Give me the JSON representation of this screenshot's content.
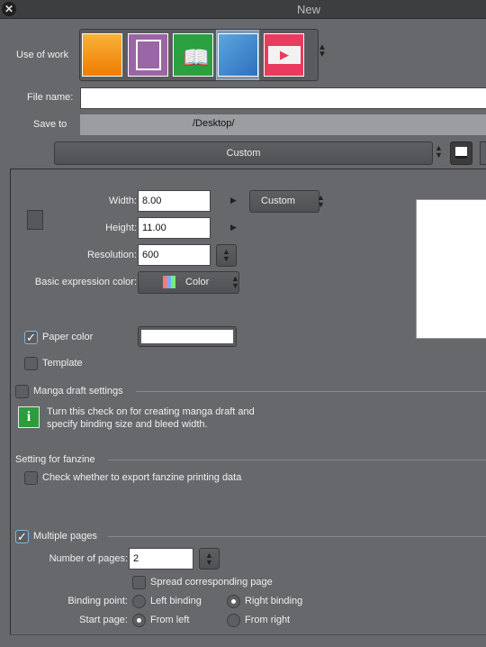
{
  "window": {
    "title": "New"
  },
  "use_of_work": {
    "label": "Use of work",
    "options": [
      "illustration",
      "comic",
      "book",
      "webtoon-print",
      "animation"
    ],
    "selected": 3,
    "colors": [
      "#f08a0a",
      "#8e5a9a",
      "#279a3a",
      "#3a7fc4",
      "#e83b5d"
    ]
  },
  "file_name": {
    "label": "File name:",
    "value": ""
  },
  "save_to": {
    "label": "Save to",
    "value": "/Desktop/"
  },
  "preset": {
    "value": "Custom"
  },
  "size": {
    "width_label": "Width:",
    "width": "8.00",
    "height_label": "Height:",
    "height": "11.00",
    "unit_preset": "Custom",
    "resolution_label": "Resolution:",
    "resolution": "600",
    "color_label": "Basic expression color:",
    "color": "Color"
  },
  "paper_color": {
    "label": "Paper color",
    "checked": true
  },
  "template": {
    "label": "Template",
    "checked": false
  },
  "manga": {
    "label": "Manga draft settings",
    "checked": false,
    "info": "Turn this check on for creating manga draft and specify binding size and bleed width."
  },
  "fanzine": {
    "heading": "Setting for fanzine",
    "label": "Check whether to export fanzine printing data",
    "checked": false
  },
  "multiple_pages": {
    "label": "Multiple pages",
    "checked": true,
    "pages_label": "Number of pages:",
    "pages": "2",
    "spread_label": "Spread corresponding page",
    "binding_label": "Binding point:",
    "left_binding": "Left binding",
    "right_binding": "Right binding",
    "binding": "right",
    "start_label": "Start page:",
    "from_left": "From left",
    "from_right": "From right",
    "start": "left"
  }
}
